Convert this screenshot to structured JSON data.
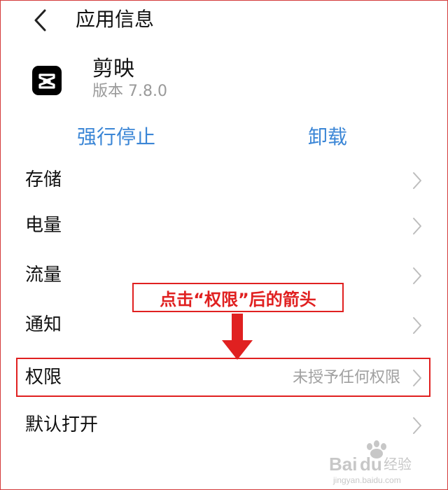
{
  "header": {
    "title": "应用信息",
    "back_icon": "chevron-left-icon"
  },
  "app": {
    "name": "剪映",
    "version": "版本 7.8.0",
    "icon": "capcut-logo-icon"
  },
  "actions": {
    "force_stop": "强行停止",
    "uninstall": "卸载",
    "accent_color": "#3b86d6"
  },
  "rows": [
    {
      "label": "存储",
      "value": ""
    },
    {
      "label": "电量",
      "value": ""
    },
    {
      "label": "流量",
      "value": ""
    },
    {
      "label": "通知",
      "value": ""
    },
    {
      "label": "权限",
      "value": "未授予任何权限"
    },
    {
      "label": "默认打开",
      "value": ""
    }
  ],
  "annotation": {
    "callout_text": "点击“权限”后的箭头",
    "color": "#e02020"
  },
  "watermark": {
    "brand": "Baidu经验",
    "url": "jingyan.baidu.com"
  }
}
